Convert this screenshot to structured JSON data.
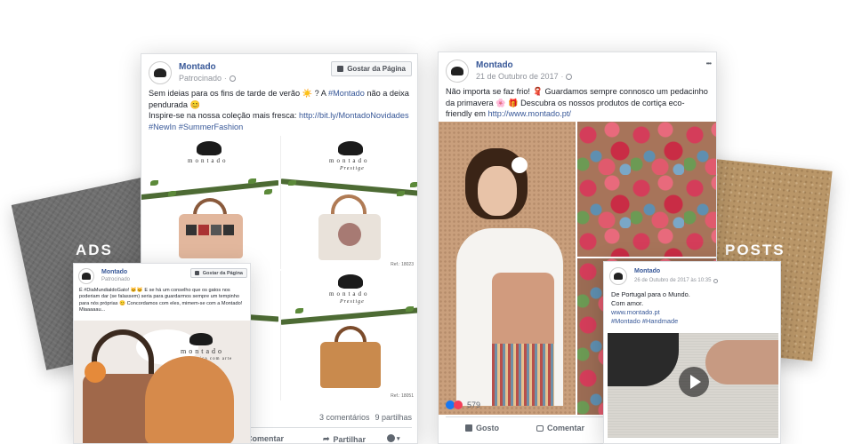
{
  "labels": {
    "ads": "ADS",
    "posts": "POSTS"
  },
  "ad_card": {
    "page_name": "Montado",
    "meta": "Patrocinado",
    "like_button": "Gostar da Página",
    "text_line1": "Sem ideias para os fins de tarde de verão ☀️ ? A ",
    "hashtag_montado": "#Montado",
    "text_line1b": " não a deixa pendurada 😊",
    "text_line2": "Inspire-se na nossa coleção mais fresca: ",
    "link": "http://bit.ly/MontadoNovidades",
    "hashtags": "#NewIn #SummerFashion",
    "brand": "montado",
    "brand_sub": "Prestige",
    "ref1": "Ref.: 18023",
    "ref2": "Ref.: 18051",
    "comments": "3 comentários",
    "shares": "9 partilhas",
    "action_comment": "Comentar",
    "action_share": "Partilhar"
  },
  "small_ad": {
    "page_name": "Montado",
    "meta": "Patrocinado",
    "like_button": "Gostar da Página",
    "text": "É #DiaMundialdoGato! 🐱🐱 E se há um conselho que os gatos nos poderiam dar (se falassem) seria para guardarmos sempre um tempinho para nós próprias 😊 Concordamos com eles, mimem-se com a Montado! Miaaaaau...",
    "brand": "montado",
    "brand_sub": "cortiça com arte"
  },
  "post_card": {
    "page_name": "Montado",
    "meta": "21 de Outubro de 2017",
    "more": "•••",
    "text": "Não importa se faz frio! 🧣 Guardamos sempre connosco um pedacinho da primavera 🌸 🎁 Descubra os nossos produtos de cortiça eco-friendly em ",
    "link": "http://www.montado.pt/",
    "reactions": "579",
    "action_like": "Gosto",
    "action_comment": "Comentar"
  },
  "small_post": {
    "page_name": "Montado",
    "meta": "26 de Outubro de 2017 às 10:35",
    "line1": "De Portugal para o Mundo.",
    "line2": "Com amor.",
    "link": "www.montado.pt",
    "hashtags": "#Montado #Handmade"
  },
  "colors": {
    "facebook_blue": "#385898",
    "like_blue": "#1877f2",
    "love_red": "#f33e58"
  }
}
